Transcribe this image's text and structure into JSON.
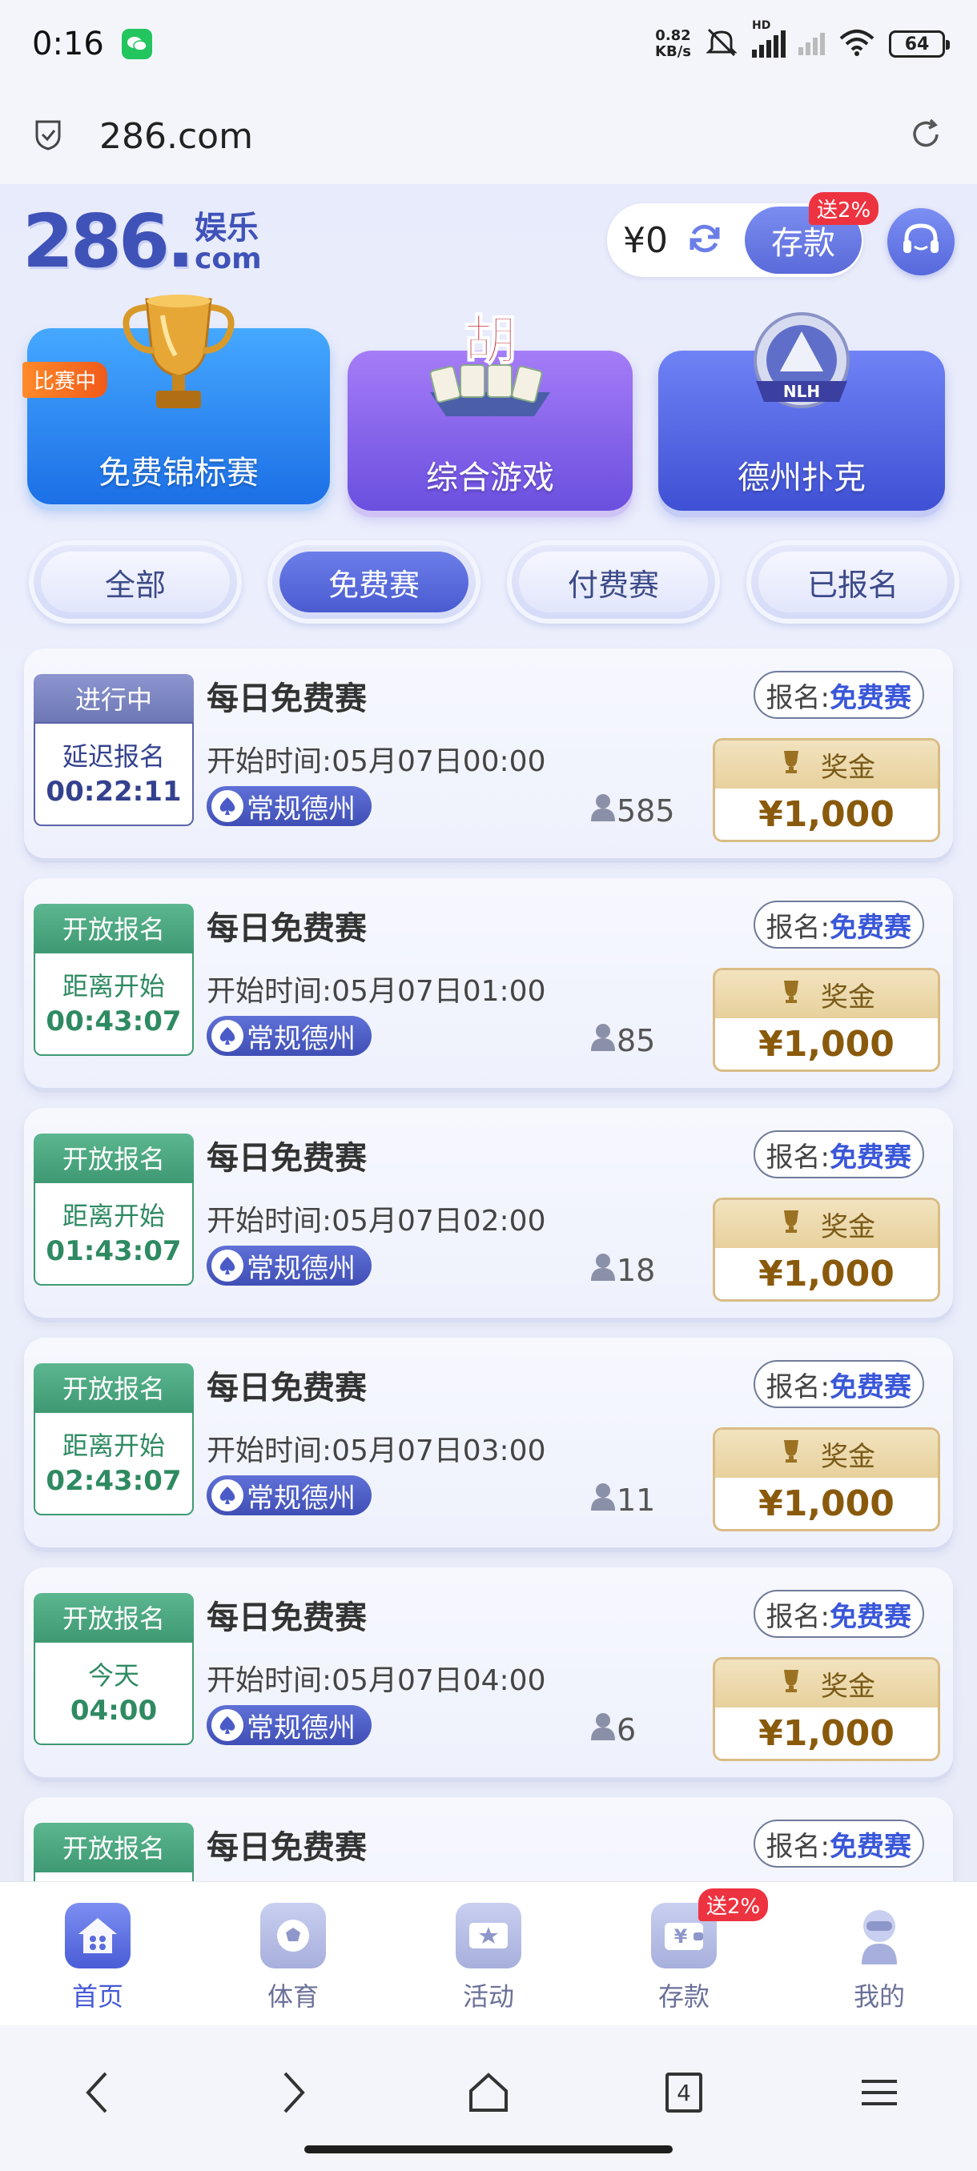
{
  "status_bar": {
    "time": "0:16",
    "net_speed_value": "0.82",
    "net_speed_unit": "KB/s",
    "signal_label": "HD",
    "battery": "64"
  },
  "browser": {
    "url": "286.com"
  },
  "header": {
    "logo_number": "286.",
    "logo_text": "娱乐",
    "logo_domain": "com",
    "balance": "¥0",
    "deposit_label": "存款",
    "deposit_badge": "送2%"
  },
  "game_cards": [
    {
      "label": "免费锦标赛",
      "tag": "比赛中"
    },
    {
      "label": "综合游戏",
      "art_text": "胡"
    },
    {
      "label": "德州扑克",
      "art_text": "NLH"
    }
  ],
  "tabs": [
    {
      "label": "全部",
      "active": false
    },
    {
      "label": "免费赛",
      "active": true
    },
    {
      "label": "付费赛",
      "active": false
    },
    {
      "label": "已报名",
      "active": false
    }
  ],
  "tournaments": [
    {
      "status": "进行中",
      "time_label": "延迟报名",
      "time_value": "00:22:11",
      "title": "每日免费赛",
      "start": "开始时间:05月07日00:00",
      "type": "常规德州",
      "signup_prefix": "报名:",
      "signup_fee": "免费赛",
      "players": "585",
      "prize_label": "奖金",
      "prize": "¥1,000"
    },
    {
      "status": "开放报名",
      "time_label": "距离开始",
      "time_value": "00:43:07",
      "title": "每日免费赛",
      "start": "开始时间:05月07日01:00",
      "type": "常规德州",
      "signup_prefix": "报名:",
      "signup_fee": "免费赛",
      "players": "85",
      "prize_label": "奖金",
      "prize": "¥1,000"
    },
    {
      "status": "开放报名",
      "time_label": "距离开始",
      "time_value": "01:43:07",
      "title": "每日免费赛",
      "start": "开始时间:05月07日02:00",
      "type": "常规德州",
      "signup_prefix": "报名:",
      "signup_fee": "免费赛",
      "players": "18",
      "prize_label": "奖金",
      "prize": "¥1,000"
    },
    {
      "status": "开放报名",
      "time_label": "距离开始",
      "time_value": "02:43:07",
      "title": "每日免费赛",
      "start": "开始时间:05月07日03:00",
      "type": "常规德州",
      "signup_prefix": "报名:",
      "signup_fee": "免费赛",
      "players": "11",
      "prize_label": "奖金",
      "prize": "¥1,000"
    },
    {
      "status": "开放报名",
      "time_label": "今天",
      "time_value": "04:00",
      "title": "每日免费赛",
      "start": "开始时间:05月07日04:00",
      "type": "常规德州",
      "signup_prefix": "报名:",
      "signup_fee": "免费赛",
      "players": "6",
      "prize_label": "奖金",
      "prize": "¥1,000"
    },
    {
      "status": "开放报名",
      "title": "每日免费赛",
      "signup_prefix": "报名:",
      "signup_fee": "免费赛"
    }
  ],
  "app_nav": [
    {
      "label": "首页",
      "icon": "home-icon",
      "active": true
    },
    {
      "label": "体育",
      "icon": "soccer-icon",
      "active": false
    },
    {
      "label": "活动",
      "icon": "star-ticket-icon",
      "active": false
    },
    {
      "label": "存款",
      "icon": "wallet-icon",
      "active": false,
      "badge": "送2%"
    },
    {
      "label": "我的",
      "icon": "profile-icon",
      "active": false
    }
  ],
  "system_nav": {
    "tab_count": "4"
  },
  "colors": {
    "brand": "#3f52b8",
    "accent": "#5a6ad9",
    "open_green": "#3f9a73",
    "prize_gold": "#8a5a0c",
    "badge_red": "#ee3340"
  }
}
